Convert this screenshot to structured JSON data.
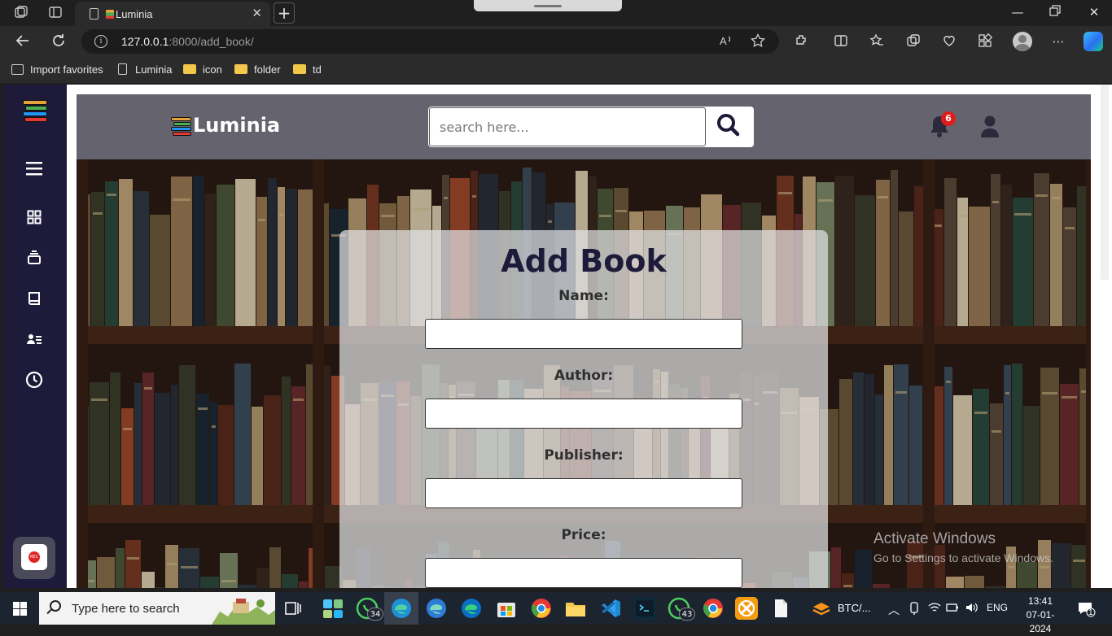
{
  "browser": {
    "tab_title": "Luminia",
    "url_host": "127.0.0.1",
    "url_rest": ":8000/add_book/",
    "favorites": [
      {
        "label": "Import favorites"
      },
      {
        "label": "Luminia"
      },
      {
        "label": "icon"
      },
      {
        "label": "folder"
      },
      {
        "label": "td"
      }
    ]
  },
  "header": {
    "brand": "Luminia",
    "search_placeholder": "search here...",
    "notification_count": "6"
  },
  "form": {
    "title": "Add Book",
    "fields": [
      {
        "label": "Name:",
        "value": ""
      },
      {
        "label": "Author:",
        "value": ""
      },
      {
        "label": "Publisher:",
        "value": ""
      },
      {
        "label": "Price:",
        "value": ""
      }
    ]
  },
  "watermark": {
    "line1": "Activate Windows",
    "line2": "Go to Settings to activate Windows."
  },
  "taskbar": {
    "search_placeholder": "Type here to search",
    "whatsapp_count": "34",
    "whatsapp2_count": "43",
    "btc_label": "BTC/...",
    "language": "ENG",
    "time": "13:41",
    "date": "07-01-2024",
    "notifications": "1"
  },
  "colors": {
    "sidebar": "#1d1b39",
    "header": "#65636e",
    "title": "#1d1b39",
    "badge": "#e01b1b"
  }
}
